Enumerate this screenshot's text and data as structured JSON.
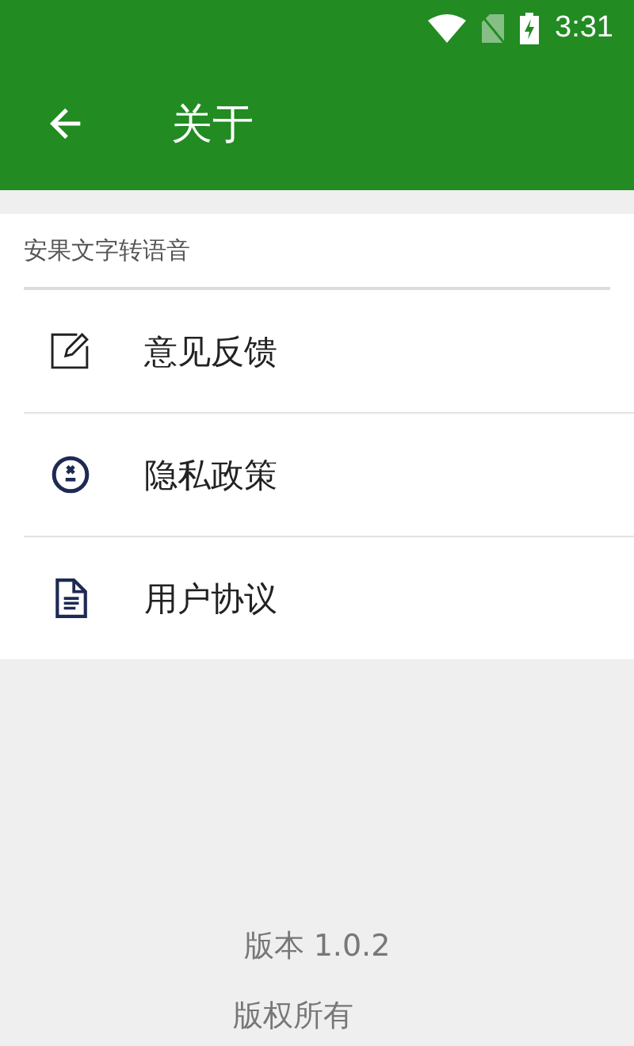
{
  "status_bar": {
    "time": "3:31"
  },
  "toolbar": {
    "title": "关于"
  },
  "section": {
    "title": "安果文字转语音"
  },
  "items": [
    {
      "kind": "feedback",
      "label": "意见反馈"
    },
    {
      "kind": "privacy",
      "label": "隐私政策"
    },
    {
      "kind": "agreement",
      "label": "用户协议"
    }
  ],
  "footer": {
    "version": "版本 1.0.2",
    "copyright": "版权所有"
  }
}
